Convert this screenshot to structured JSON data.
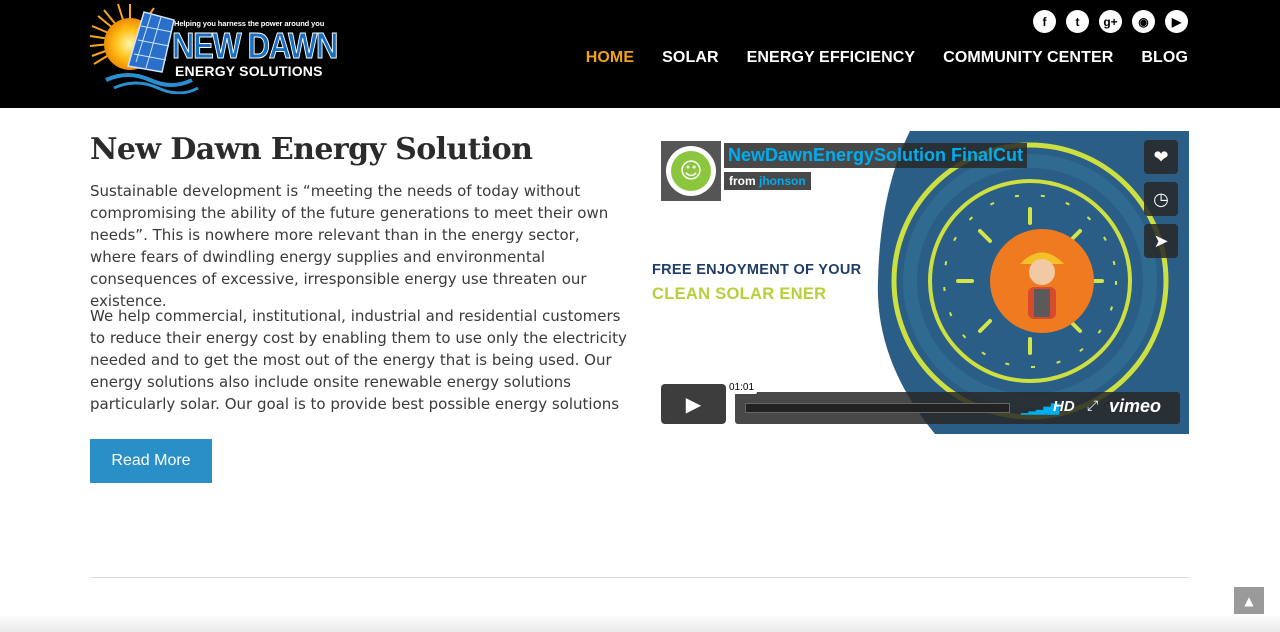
{
  "header": {
    "logo": {
      "tagline": "Helping you harness the power around you",
      "title": "NEW DAWN",
      "subtitle": "ENERGY SOLUTIONS"
    },
    "social_icons": [
      "facebook-icon",
      "twitter-icon",
      "google-plus-icon",
      "rss-icon",
      "youtube-icon"
    ],
    "social_glyphs": {
      "facebook": "f",
      "twitter": "t",
      "googleplus": "g+",
      "rss": "◉",
      "youtube": "▶"
    },
    "nav": {
      "home": "HOME",
      "solar": "SOLAR",
      "energy_efficiency": "ENERGY EFFICIENCY",
      "community_center": "COMMUNITY CENTER",
      "blog": "BLOG"
    }
  },
  "main": {
    "heading": "New Dawn Energy Solution",
    "paragraph1": "Sustainable development is “meeting the needs of today without compromising the ability of the future generations to meet their own needs”. This is nowhere more relevant than in the energy sector, where fears of dwindling energy supplies and environmental consequences of excessive, irresponsible energy use threaten our existence.",
    "paragraph2": "We help commercial, institutional, industrial and residential customers to reduce their energy cost by enabling them to use only the electricity needed and to get the most out of the energy that is being used. Our energy solutions also include onsite renewable energy solutions particularly solar. Our goal is to provide best possible energy solutions",
    "read_more_label": "Read More"
  },
  "video": {
    "title": "NewDawnEnergySolution FinalCut",
    "byline_prefix": "from",
    "author": "jhonson",
    "overlay_line1": "FREE ENJOYMENT OF YOUR",
    "overlay_line2": "CLEAN SOLAR ENER",
    "time": "01:01",
    "hd_label": "HD",
    "brand": "vimeo",
    "side_buttons": [
      "like-icon",
      "watch-later-icon",
      "share-icon"
    ]
  },
  "colors": {
    "nav_active": "#f0a21c",
    "button": "#2a8fc7",
    "vimeo_blue": "#00adef",
    "header_bg": "#000000"
  }
}
